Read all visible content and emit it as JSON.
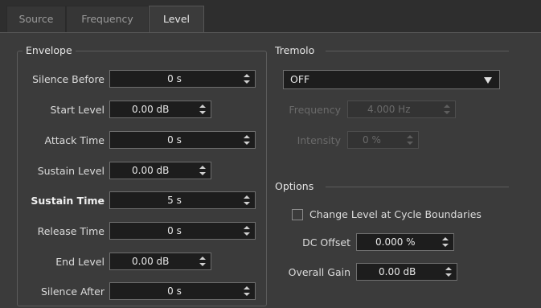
{
  "tabs": [
    {
      "label": "Source",
      "active": false
    },
    {
      "label": "Frequency",
      "active": false
    },
    {
      "label": "Level",
      "active": true
    }
  ],
  "envelope": {
    "title": "Envelope",
    "silence_before": {
      "label": "Silence Before",
      "value": "0 s"
    },
    "start_level": {
      "label": "Start Level",
      "value": "0.00 dB"
    },
    "attack_time": {
      "label": "Attack Time",
      "value": "0 s"
    },
    "sustain_level": {
      "label": "Sustain Level",
      "value": "0.00 dB"
    },
    "sustain_time": {
      "label": "Sustain Time",
      "value": "5 s"
    },
    "release_time": {
      "label": "Release Time",
      "value": "0 s"
    },
    "end_level": {
      "label": "End Level",
      "value": "0.00 dB"
    },
    "silence_after": {
      "label": "Silence After",
      "value": "0 s"
    }
  },
  "tremolo": {
    "title": "Tremolo",
    "mode": {
      "value": "OFF"
    },
    "frequency": {
      "label": "Frequency",
      "value": "4.000 Hz",
      "disabled": true
    },
    "intensity": {
      "label": "Intensity",
      "value": "0 %",
      "disabled": true
    }
  },
  "options": {
    "title": "Options",
    "change_level": {
      "label": "Change Level at Cycle Boundaries",
      "checked": false
    },
    "dc_offset": {
      "label": "DC Offset",
      "value": "0.000 %"
    },
    "overall_gain": {
      "label": "Overall Gain",
      "value": "0.00 dB"
    }
  }
}
